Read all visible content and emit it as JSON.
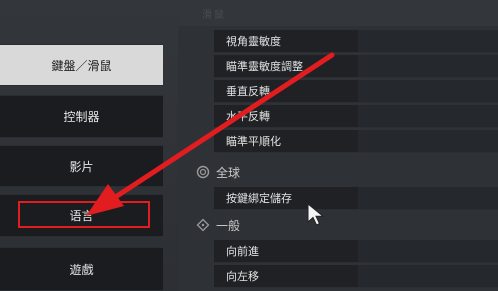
{
  "sidebar": {
    "items": [
      {
        "label": "鍵盤／滑鼠",
        "active": true
      },
      {
        "label": "控制器",
        "active": false
      },
      {
        "label": "影片",
        "active": false
      },
      {
        "label": "语言",
        "active": false
      },
      {
        "label": "遊戲",
        "active": false
      }
    ]
  },
  "top": {
    "faint_label": "滑鼠"
  },
  "mouse_settings": [
    "視角靈敏度",
    "瞄準靈敏度調整",
    "垂直反轉",
    "水平反轉",
    "瞄準平順化"
  ],
  "global": {
    "header": "全球",
    "items": [
      "按鍵綁定儲存"
    ]
  },
  "general": {
    "header": "一般",
    "items": [
      "向前進",
      "向左移"
    ]
  },
  "annotation": {
    "color": "#e11d20",
    "icons": [
      "red-arrow-icon",
      "cursor-icon"
    ]
  }
}
